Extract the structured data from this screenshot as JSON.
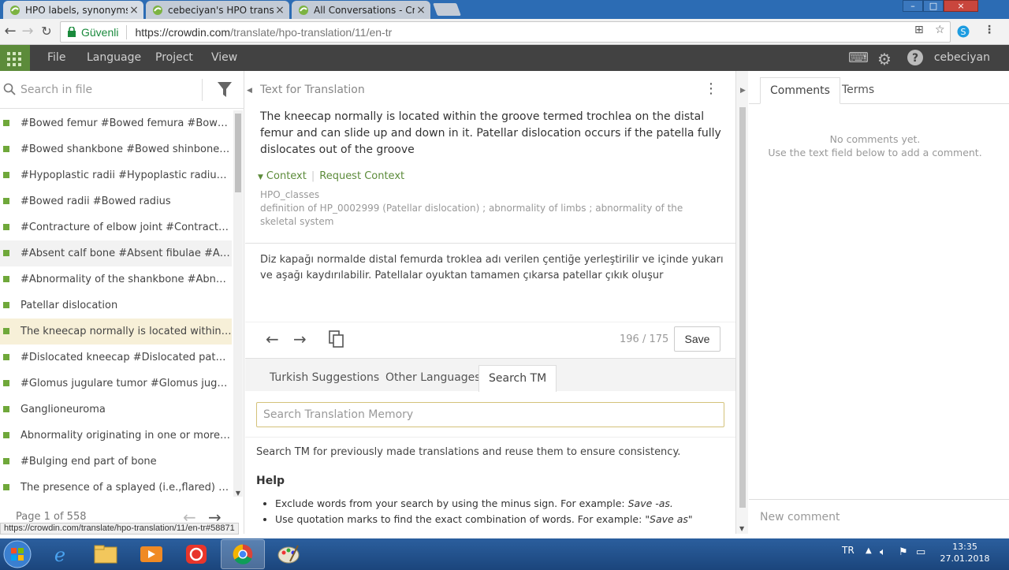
{
  "browser": {
    "tabs": [
      {
        "label": "HPO labels, synonyms, a",
        "active": true
      },
      {
        "label": "cebeciyan's HPO translat",
        "active": false
      },
      {
        "label": "All Conversations - Crow",
        "active": false
      }
    ],
    "close_glyph": "×",
    "window_controls": [
      "–",
      "□",
      "×"
    ],
    "secure_label": "Güvenli",
    "url_host": "https://crowdin.com",
    "url_path": "/translate/hpo-translation/11/en-tr"
  },
  "menubar": {
    "items": [
      "File",
      "Language",
      "Project",
      "View"
    ],
    "user": "cebeciyan"
  },
  "left_panel": {
    "search_placeholder": "Search in file",
    "strings": [
      "#Bowed femur #Bowed femura #Bowed fe...",
      "#Bowed shankbone #Bowed shinbone #Bo...",
      "#Hypoplastic radii #Hypoplastic radius #Ra...",
      "#Bowed radii #Bowed radius",
      "#Contracture of elbow joint #Contractures ...",
      "#Absent calf bone #Absent fibulae #Absent...",
      "#Abnormality of the shankbone #Abnorma...",
      "Patellar dislocation",
      "The kneecap normally is located within the ...",
      "#Dislocated kneecap #Dislocated patellae ...",
      "#Glomus jugulare tumor #Glomus jugulare...",
      "Ganglioneuroma",
      "Abnormality originating in one or more mu...",
      "#Bulging end part of bone",
      "The presence of a splayed (i.e.,flared) meta..."
    ],
    "page_label": "Page 1 of 558"
  },
  "status_url": "https://crowdin.com/translate/hpo-translation/11/en-tr#58871",
  "editor": {
    "title": "Text for Translation",
    "source_text": "The kneecap normally is located within the groove termed trochlea on the distal femur and can slide up and down in it. Patellar dislocation occurs if the patella fully dislocates out of the groove",
    "context_label": "Context",
    "request_context_label": "Request Context",
    "context_file": "HPO_classes",
    "context_definition": "definition of HP_0002999 (Patellar dislocation) ; abnormality of limbs ; abnormality of the skeletal system",
    "translation_text": "Diz kapağı normalde distal femurda troklea adı verilen çentiğe yerleştirilir ve içinde yukarı ve aşağı kaydırılabilir. Patellalar oyuktan tamamen çıkarsa patellar çıkık oluşur",
    "char_count": "196 / 175",
    "save_label": "Save"
  },
  "tm": {
    "tabs": [
      "Turkish Suggestions",
      "Other Languages",
      "Search TM"
    ],
    "selected_tab": "Search TM",
    "search_placeholder": "Search Translation Memory",
    "hint": "Search TM for previously made translations and reuse them to ensure consistency.",
    "help_title": "Help",
    "help_items": [
      {
        "text": "Exclude words from your search by using the minus sign. For example: ",
        "example": "Save -as."
      },
      {
        "text": "Use quotation marks to find the exact combination of words. For example: ",
        "example": "\"Save as\""
      }
    ]
  },
  "comments": {
    "tabs": [
      "Comments",
      "Terms"
    ],
    "empty_line1": "No comments yet.",
    "empty_line2": "Use the text field below to add a comment.",
    "new_comment_placeholder": "New comment"
  },
  "taskbar": {
    "lang": "TR",
    "time": "13:35",
    "date": "27.01.2018"
  },
  "colors": {
    "accent_green": "#6fa83a",
    "menubar_bg": "#424242",
    "taskbar_bg": "#1b457c"
  }
}
